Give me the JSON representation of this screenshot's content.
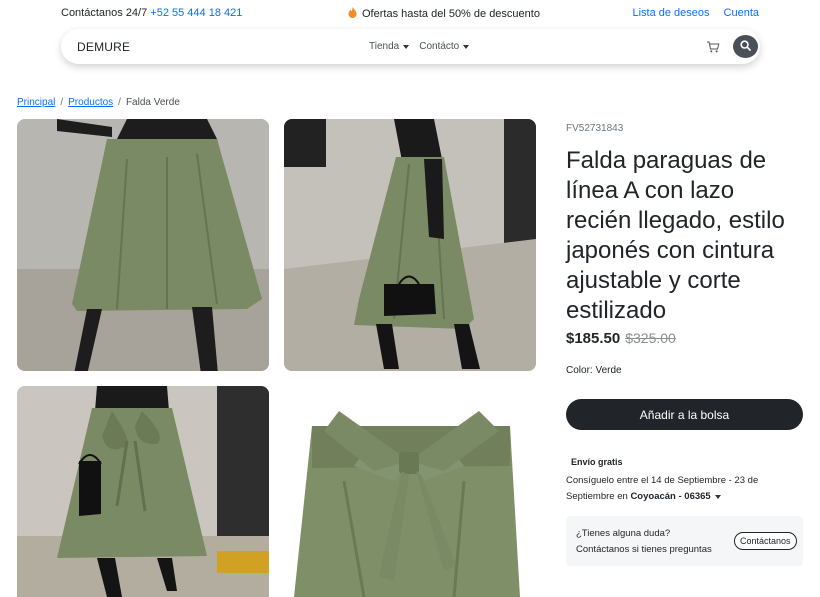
{
  "topbar": {
    "contact_label": "Contáctanos 24/7",
    "phone": "+52 55 444 18 421",
    "promo": "Ofertas hasta del 50% de descuento",
    "wishlist": "Lista de deseos",
    "account": "Cuenta"
  },
  "navbar": {
    "brand": "DEMURE",
    "menu": [
      "Tienda",
      "Contácto"
    ],
    "icons": {
      "cart": "cart-icon",
      "search": "search-icon"
    }
  },
  "breadcrumb": {
    "items": [
      "Principal",
      "Productos"
    ],
    "separator": "/",
    "current": "Falda Verde"
  },
  "product": {
    "sku": "FV52731843",
    "title": "Falda paraguas de línea A con lazo recién llegado, estilo japonés con cintura ajustable y corte estilizado",
    "price": "$185.50",
    "old_price": "$325.00",
    "color_label": "Color:",
    "color_value": "Verde",
    "add_to_bag": "Añadir a la bolsa"
  },
  "shipping": {
    "title": "Envío gratis",
    "text": "Consíguelo entre el 14 de Septiembre - 23 de Septiembre en",
    "location": "Coyoacán - 06365"
  },
  "help": {
    "question": "¿Tienes alguna duda?",
    "subtitle": "Contáctanos si tienes preguntas",
    "button": "Contáctanos"
  },
  "colors": {
    "accent": "#0d6efd",
    "dark": "#212529",
    "skirt": "#7a8a64",
    "promo_flame": "#f28c28"
  }
}
